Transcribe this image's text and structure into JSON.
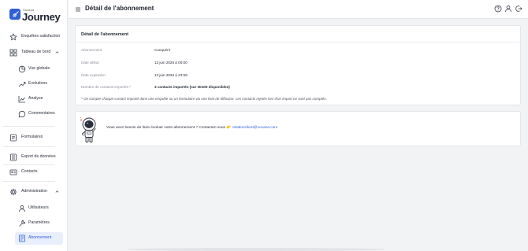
{
  "sidebar": {
    "logo_small": "Vocaza",
    "logo_big": "Journey",
    "items": [
      {
        "label": "Enquêtes satisfaction",
        "icon": "star-icon"
      },
      {
        "label": "Tableau de bord",
        "icon": "dashboard-grid-icon"
      },
      {
        "label": "Vue globale",
        "icon": "pie-chart-icon"
      },
      {
        "label": "Evolutions",
        "icon": "trend-icon"
      },
      {
        "label": "Analyse",
        "icon": "line-chart-icon"
      },
      {
        "label": "Commentaires",
        "icon": "comment-icon"
      },
      {
        "label": "Formulaires",
        "icon": "form-icon"
      },
      {
        "label": "Export de données",
        "icon": "export-icon"
      },
      {
        "label": "Contacts",
        "icon": "contact-card-icon"
      },
      {
        "label": "Administration",
        "icon": "gear-icon"
      },
      {
        "label": "Utilisateurs",
        "icon": "user-icon"
      },
      {
        "label": "Paramètres",
        "icon": "wrench-icon"
      },
      {
        "label": "Abonnement",
        "icon": "subscription-icon"
      }
    ]
  },
  "header": {
    "title": "Détail de l'abonnement"
  },
  "detail": {
    "title": "Détail de l'abonnement",
    "rows": [
      {
        "label": "Abonnement",
        "value": "Conquérir"
      },
      {
        "label": "Date début",
        "value": "12 juin 2025 à 00:00"
      },
      {
        "label": "Date expiration",
        "value": "13 juin 2026 à 23:59"
      },
      {
        "label": "Nombre de contacts importés *",
        "value": "3 contacts importés (sur 30100 disponibles)"
      }
    ],
    "note": "* On compte chaque contact importé dans une enquête ou un formulaire via une liste de diffusion. Les contacts rejetés lors d'un import ne sont pas comptés."
  },
  "contact": {
    "text": "Vous avez besoin de faire évoluer votre abonnement ? Contactez-nous",
    "emoji": "👉",
    "email": "relationclient@vocaza.com"
  },
  "colors": {
    "accent": "#2f5fd3",
    "active_bg": "#e8eefc",
    "page_bg": "#f2f3f5"
  }
}
